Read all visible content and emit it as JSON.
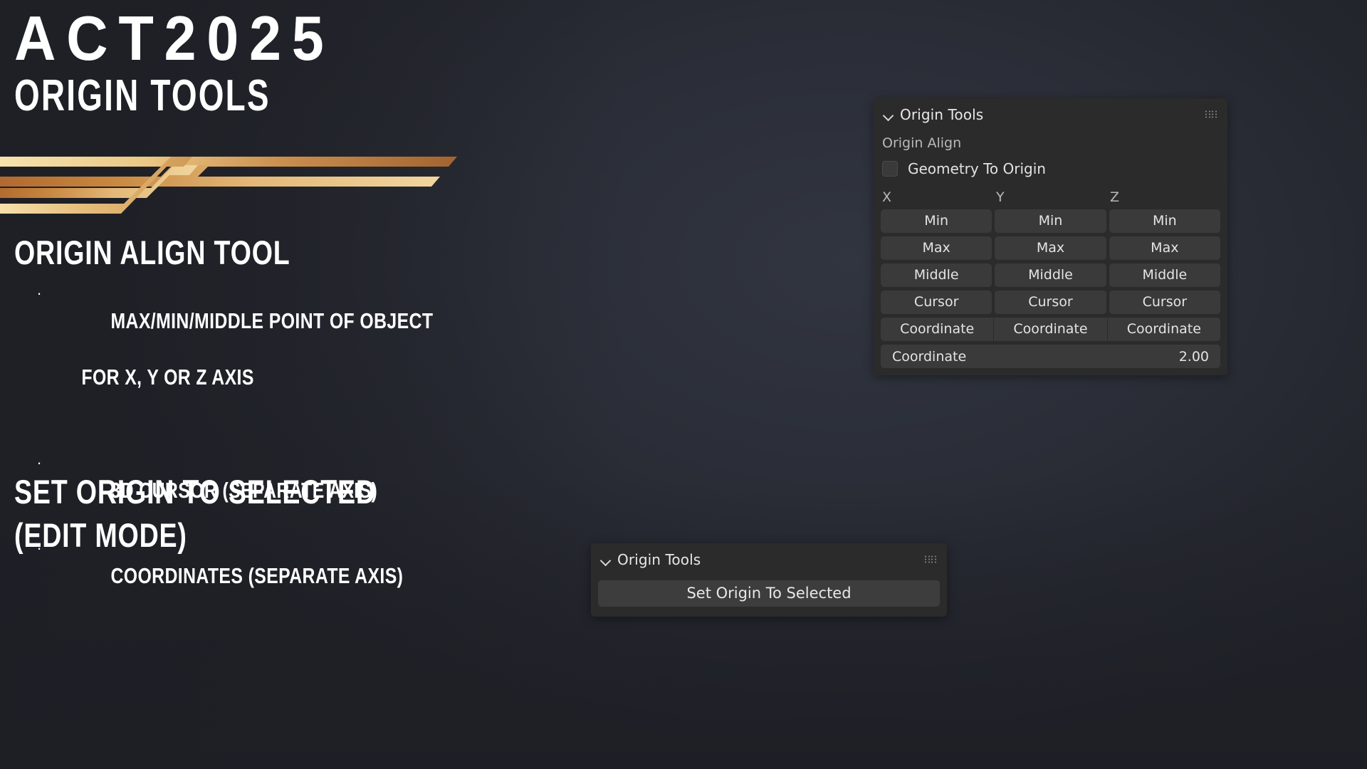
{
  "slide": {
    "title": "ACT2025",
    "subtitle": "ORIGIN TOOLS",
    "section_1_heading": "ORIGIN ALIGN TOOL",
    "bullets": [
      {
        "line1": "MAX/MIN/MIDDLE POINT OF OBJECT",
        "line2": "FOR X, Y OR Z AXIS"
      },
      {
        "line1": "3D CURSOR (SEPARATE AXIS)",
        "line2": ""
      },
      {
        "line1": "COORDINATES (SEPARATE AXIS)",
        "line2": ""
      }
    ],
    "section_2_heading_line1": "SET ORIGIN TO SELECTED",
    "section_2_heading_line2": "(EDIT MODE)",
    "bullet_glyph": "·",
    "colors": {
      "background": "#2b2e37",
      "text": "#ffffff",
      "gold_light": "#f2d79a",
      "gold_mid": "#d8a85e",
      "gold_dark": "#b06a33"
    }
  },
  "panel_main": {
    "title": "Origin Tools",
    "collapse_icon": "chevron-down-icon",
    "drag_icon": "drag-handle-icon",
    "sublabel": "Origin Align",
    "checkbox": {
      "label": "Geometry To Origin",
      "checked": false
    },
    "axis_headers": [
      "X",
      "Y",
      "Z"
    ],
    "rows": [
      {
        "name": "min-row",
        "joined": false,
        "labels": [
          "Min",
          "Min",
          "Min"
        ]
      },
      {
        "name": "max-row",
        "joined": false,
        "labels": [
          "Max",
          "Max",
          "Max"
        ]
      },
      {
        "name": "middle-row",
        "joined": false,
        "labels": [
          "Middle",
          "Middle",
          "Middle"
        ]
      },
      {
        "name": "cursor-row",
        "joined": false,
        "labels": [
          "Cursor",
          "Cursor",
          "Cursor"
        ]
      },
      {
        "name": "coordinate-row",
        "joined": true,
        "labels": [
          "Coordinate",
          "Coordinate",
          "Coordinate"
        ]
      }
    ],
    "coordinate_field": {
      "label": "Coordinate",
      "value": "2.00"
    }
  },
  "panel_bottom": {
    "title": "Origin Tools",
    "collapse_icon": "chevron-down-icon",
    "drag_icon": "drag-handle-icon",
    "button_label": "Set Origin To Selected"
  }
}
